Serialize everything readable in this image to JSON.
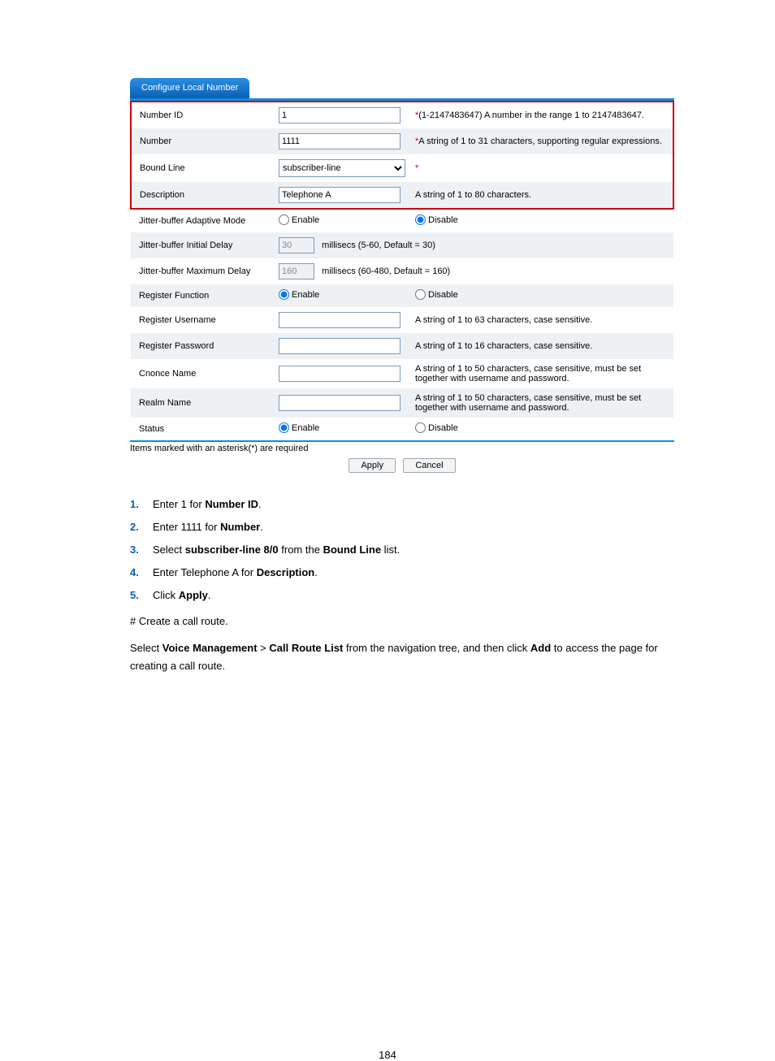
{
  "tab_title": "Configure Local Number",
  "rows": {
    "number_id": {
      "label": "Number ID",
      "value": "1",
      "hint_prefix": "*",
      "hint": "(1-2147483647) A number in the range 1 to 2147483647."
    },
    "number": {
      "label": "Number",
      "value": "1111",
      "hint_prefix": "*",
      "hint": "A string of 1 to 31 characters, supporting regular expressions."
    },
    "bound_line": {
      "label": "Bound Line",
      "value": "subscriber-line",
      "hint_prefix": "*",
      "hint": ""
    },
    "description": {
      "label": "Description",
      "value": "Telephone A",
      "hint": "A string of 1 to 80 characters."
    },
    "jb_adaptive": {
      "label": "Jitter-buffer Adaptive Mode",
      "enable": "Enable",
      "disable": "Disable"
    },
    "jb_initial": {
      "label": "Jitter-buffer Initial Delay",
      "value": "30",
      "hint": "millisecs (5-60, Default = 30)"
    },
    "jb_max": {
      "label": "Jitter-buffer Maximum Delay",
      "value": "160",
      "hint": "millisecs (60-480, Default = 160)"
    },
    "reg_func": {
      "label": "Register Function",
      "enable": "Enable",
      "disable": "Disable"
    },
    "reg_user": {
      "label": "Register Username",
      "hint": "A string of 1 to 63 characters, case sensitive."
    },
    "reg_pass": {
      "label": "Register Password",
      "hint": "A string of 1 to 16 characters, case sensitive."
    },
    "cnonce": {
      "label": "Cnonce Name",
      "hint": " A string of 1 to 50 characters, case sensitive, must be set together with username and password."
    },
    "realm": {
      "label": "Realm Name",
      "hint": " A string of 1 to 50 characters, case sensitive, must be set together with username and password."
    },
    "status": {
      "label": "Status",
      "enable": "Enable",
      "disable": "Disable"
    }
  },
  "asterisk_note": "Items marked with an asterisk(*) are required",
  "buttons": {
    "apply": "Apply",
    "cancel": "Cancel"
  },
  "steps": [
    {
      "n": "1.",
      "pre": "Enter 1 for ",
      "bold": "Number ID",
      "post": "."
    },
    {
      "n": "2.",
      "pre": "Enter 1111 for ",
      "bold": "Number",
      "post": "."
    },
    {
      "n": "3.",
      "pre": "Select ",
      "bold": "subscriber-line 8/0",
      "post_pre": " from the ",
      "bold2": "Bound Line",
      "post": " list."
    },
    {
      "n": "4.",
      "pre": "Enter Telephone A for ",
      "bold": "Description",
      "post": "."
    },
    {
      "n": "5.",
      "pre": "Click ",
      "bold": "Apply",
      "post": "."
    }
  ],
  "hash_line": "# Create a call route.",
  "nav_line": {
    "pre": "Select ",
    "b1": "Voice Management",
    "mid1": " > ",
    "b2": "Call Route List",
    "mid2": " from the navigation tree, and then click ",
    "b3": "Add",
    "post": " to access the page for creating a call route."
  },
  "page_number": "184"
}
